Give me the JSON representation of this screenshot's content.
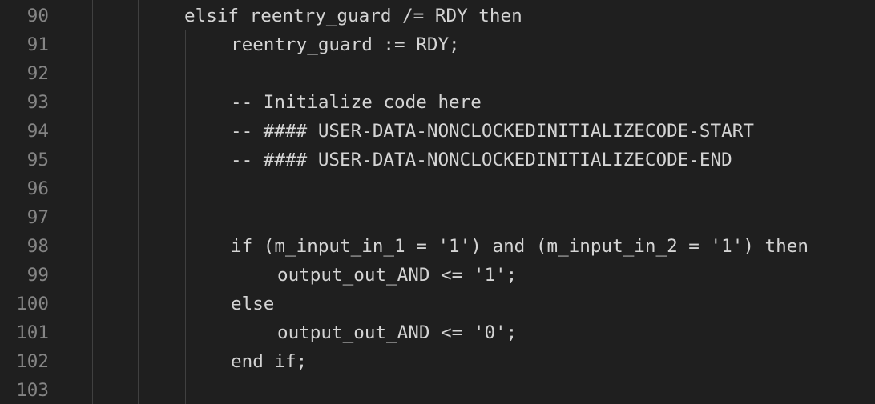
{
  "editor": {
    "theme": {
      "background": "#1f1f1f",
      "text": "#d4d4d4",
      "line_number": "#858585",
      "indent_guide": "#404040"
    },
    "lines": [
      {
        "number": "90",
        "text": "elsif reentry_guard /= RDY then"
      },
      {
        "number": "91",
        "text": "reentry_guard := RDY;"
      },
      {
        "number": "92",
        "text": ""
      },
      {
        "number": "93",
        "text": "-- Initialize code here"
      },
      {
        "number": "94",
        "text": "-- #### USER-DATA-NONCLOCKEDINITIALIZECODE-START"
      },
      {
        "number": "95",
        "text": "-- #### USER-DATA-NONCLOCKEDINITIALIZECODE-END"
      },
      {
        "number": "96",
        "text": ""
      },
      {
        "number": "97",
        "text": ""
      },
      {
        "number": "98",
        "text": "if (m_input_in_1 = '1') and (m_input_in_2 = '1') then"
      },
      {
        "number": "99",
        "text": "output_out_AND <= '1';"
      },
      {
        "number": "100",
        "text": "else"
      },
      {
        "number": "101",
        "text": "output_out_AND <= '0';"
      },
      {
        "number": "102",
        "text": "end if;"
      },
      {
        "number": "103",
        "text": ""
      }
    ]
  }
}
